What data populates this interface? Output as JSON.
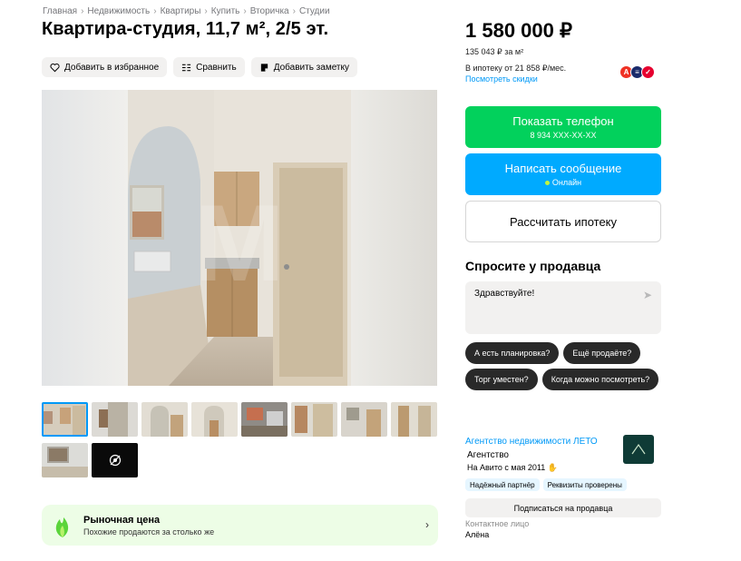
{
  "breadcrumb": [
    "Главная",
    "Недвижимость",
    "Квартиры",
    "Купить",
    "Вторичка",
    "Студии"
  ],
  "title": "Квартира-студия, 11,7 м², 2/5 эт.",
  "actions": {
    "favorite": "Добавить в избранное",
    "compare": "Сравнить",
    "note": "Добавить заметку"
  },
  "price": {
    "total": "1 580 000 ₽",
    "per_m2": "135 043 ₽ за м²",
    "mortgage": "В ипотеку от 21 858 ₽/мес.",
    "discounts_link": "Посмотреть скидки"
  },
  "buttons": {
    "show_phone": "Показать телефон",
    "phone_mask": "8 934 XXX-XX-XX",
    "write_message": "Написать сообщение",
    "online": "Онлайн",
    "calc_mortgage": "Рассчитать ипотеку"
  },
  "ask": {
    "title": "Спросите у продавца",
    "message": "Здравствуйте!",
    "chips": [
      "А есть планировка?",
      "Ещё продаёте?",
      "Торг уместен?",
      "Когда можно посмотреть?"
    ]
  },
  "seller": {
    "name": "Агентство недвижимости ЛЕТО",
    "type": "Агентство",
    "since": "На Авито с мая 2011",
    "badges": [
      "Надёжный партнёр",
      "Реквизиты проверены"
    ],
    "subscribe": "Подписаться на продавца",
    "contact_label": "Контактное лицо",
    "contact_name": "Алёна"
  },
  "market": {
    "title": "Рыночная цена",
    "subtitle": "Похожие продаются за столько же"
  },
  "colors": {
    "green": "#02d15c",
    "blue": "#00aaff",
    "link": "#0099f7",
    "chip_bg": "#f2f1f0",
    "dark_chip": "#292929"
  }
}
